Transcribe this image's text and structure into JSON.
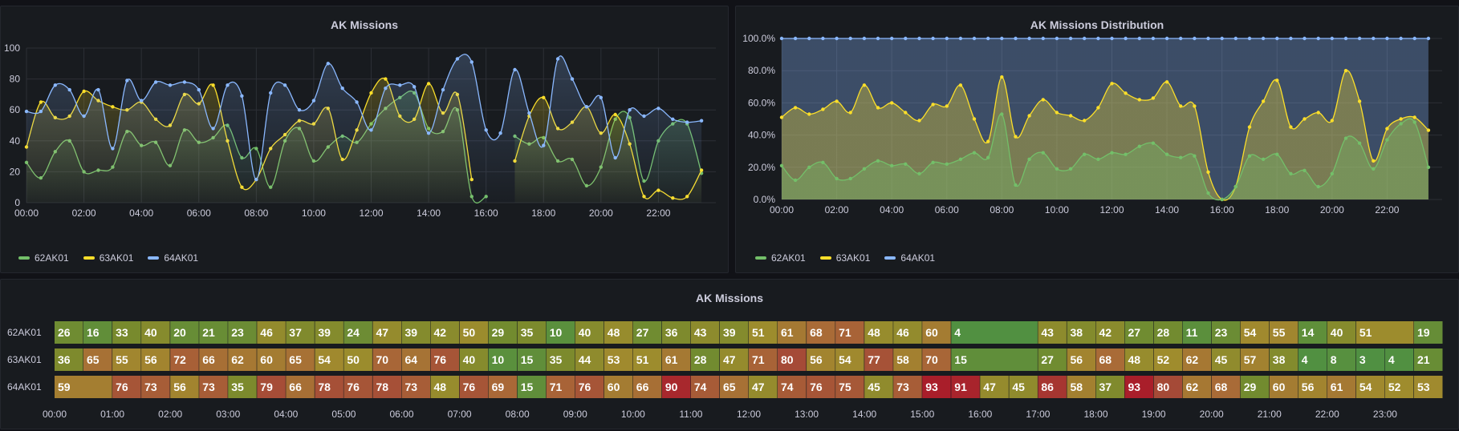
{
  "colors": {
    "s62": "#73bf69",
    "s63": "#fade2a",
    "s64": "#8ab8ff",
    "grid": "#2c2f36",
    "text": "#ccccdc",
    "bg": "#181b1f"
  },
  "panels": {
    "missions_title": "AK Missions",
    "distribution_title": "AK Missions Distribution",
    "table_title": "AK Missions"
  },
  "chart_data": [
    {
      "type": "line",
      "title": "AK Missions",
      "xlabel": "",
      "ylabel": "",
      "ylim": [
        0,
        100
      ],
      "yticks": [
        "0",
        "20",
        "40",
        "60",
        "80",
        "100"
      ],
      "xticks": [
        "00:00",
        "02:00",
        "04:00",
        "06:00",
        "08:00",
        "10:00",
        "12:00",
        "14:00",
        "16:00",
        "18:00",
        "20:00",
        "22:00"
      ],
      "x_hours": [
        0,
        0.5,
        1,
        1.5,
        2,
        2.5,
        3,
        3.5,
        4,
        4.5,
        5,
        5.5,
        6,
        6.5,
        7,
        7.5,
        8,
        8.5,
        9,
        9.5,
        10,
        10.5,
        11,
        11.5,
        12,
        12.5,
        13,
        13.5,
        14,
        14.5,
        15,
        15.5,
        16,
        16.5,
        17,
        17.5,
        18,
        18.5,
        19,
        19.5,
        20,
        20.5,
        21,
        21.5,
        22,
        22.5,
        23,
        23.5
      ],
      "series": [
        {
          "name": "62AK01",
          "color": "#73bf69",
          "values": [
            26,
            16,
            33,
            40,
            20,
            21,
            23,
            46,
            37,
            39,
            24,
            47,
            39,
            42,
            50,
            29,
            35,
            10,
            40,
            48,
            27,
            36,
            43,
            39,
            51,
            61,
            68,
            71,
            48,
            46,
            60,
            4,
            4,
            null,
            43,
            38,
            42,
            27,
            28,
            11,
            23,
            54,
            55,
            14,
            40,
            51,
            51,
            19
          ]
        },
        {
          "name": "63AK01",
          "color": "#fade2a",
          "values": [
            36,
            65,
            55,
            56,
            72,
            66,
            62,
            60,
            65,
            54,
            50,
            70,
            64,
            76,
            40,
            10,
            15,
            35,
            44,
            53,
            51,
            61,
            28,
            47,
            71,
            80,
            56,
            54,
            77,
            58,
            70,
            15,
            null,
            null,
            27,
            56,
            68,
            48,
            52,
            62,
            45,
            57,
            38,
            4,
            8,
            3,
            4,
            21
          ]
        },
        {
          "name": "64AK01",
          "color": "#8ab8ff",
          "values": [
            59,
            59,
            76,
            73,
            56,
            73,
            35,
            79,
            66,
            78,
            76,
            78,
            73,
            48,
            76,
            69,
            15,
            71,
            76,
            60,
            66,
            90,
            74,
            65,
            47,
            74,
            76,
            75,
            45,
            73,
            93,
            91,
            47,
            45,
            86,
            58,
            37,
            93,
            80,
            62,
            68,
            29,
            60,
            56,
            61,
            54,
            52,
            53
          ]
        }
      ],
      "legend": [
        "62AK01",
        "63AK01",
        "64AK01"
      ]
    },
    {
      "type": "area",
      "title": "AK Missions Distribution",
      "stacking": "percent",
      "ylim": [
        0,
        100
      ],
      "yticks": [
        "0.0%",
        "20.0%",
        "40.0%",
        "60.0%",
        "80.0%",
        "100.0%"
      ],
      "xticks": [
        "00:00",
        "02:00",
        "04:00",
        "06:00",
        "08:00",
        "10:00",
        "12:00",
        "14:00",
        "16:00",
        "18:00",
        "20:00",
        "22:00"
      ],
      "series": [
        {
          "name": "62AK01",
          "color": "#73bf69",
          "values": [
            21,
            12,
            20,
            23,
            13,
            13,
            19,
            24,
            21,
            22,
            16,
            23,
            22,
            25,
            29,
            26,
            53,
            9,
            25,
            29,
            19,
            19,
            28,
            25,
            29,
            28,
            33,
            35,
            28,
            26,
            27,
            4,
            0,
            8,
            27,
            25,
            28,
            16,
            18,
            8,
            16,
            38,
            35,
            19,
            37,
            47,
            48,
            20
          ]
        },
        {
          "name": "63AK01",
          "color": "#fade2a",
          "values": [
            51,
            57,
            53,
            56,
            61,
            54,
            71,
            57,
            60,
            54,
            49,
            59,
            58,
            71,
            50,
            36,
            76,
            39,
            52,
            62,
            54,
            52,
            49,
            57,
            72,
            66,
            62,
            63,
            73,
            58,
            58,
            17,
            0,
            8,
            45,
            61,
            74,
            45,
            50,
            54,
            49,
            80,
            61,
            24,
            44,
            50,
            51,
            43
          ]
        },
        {
          "name": "64AK01",
          "color": "#8ab8ff",
          "values": [
            100,
            100,
            100,
            100,
            100,
            100,
            100,
            100,
            100,
            100,
            100,
            100,
            100,
            100,
            100,
            100,
            100,
            100,
            100,
            100,
            100,
            100,
            100,
            100,
            100,
            100,
            100,
            100,
            100,
            100,
            100,
            100,
            100,
            100,
            100,
            100,
            100,
            100,
            100,
            100,
            100,
            100,
            100,
            100,
            100,
            100,
            100,
            100
          ]
        }
      ],
      "legend": [
        "62AK01",
        "63AK01",
        "64AK01"
      ]
    },
    {
      "type": "heatmap",
      "title": "AK Missions",
      "rows": [
        "62AK01",
        "63AK01",
        "64AK01"
      ],
      "xticks": [
        "00:00",
        "01:00",
        "02:00",
        "03:00",
        "04:00",
        "05:00",
        "06:00",
        "07:00",
        "08:00",
        "09:00",
        "10:00",
        "11:00",
        "12:00",
        "13:00",
        "14:00",
        "15:00",
        "16:00",
        "17:00",
        "18:00",
        "19:00",
        "20:00",
        "21:00",
        "22:00",
        "23:00"
      ],
      "cells": [
        [
          [
            "26",
            1
          ],
          [
            "16",
            1
          ],
          [
            "33",
            1
          ],
          [
            "40",
            1
          ],
          [
            "20",
            1
          ],
          [
            "21",
            1
          ],
          [
            "23",
            1
          ],
          [
            "46",
            1
          ],
          [
            "37",
            1
          ],
          [
            "39",
            1
          ],
          [
            "24",
            1
          ],
          [
            "47",
            1
          ],
          [
            "39",
            1
          ],
          [
            "42",
            1
          ],
          [
            "50",
            1
          ],
          [
            "29",
            1
          ],
          [
            "35",
            1
          ],
          [
            "10",
            1
          ],
          [
            "40",
            1
          ],
          [
            "48",
            1
          ],
          [
            "27",
            1
          ],
          [
            "36",
            1
          ],
          [
            "43",
            1
          ],
          [
            "39",
            1
          ],
          [
            "51",
            1
          ],
          [
            "61",
            1
          ],
          [
            "68",
            1
          ],
          [
            "71",
            1
          ],
          [
            "48",
            1
          ],
          [
            "46",
            1
          ],
          [
            "60",
            1
          ],
          [
            "4",
            3
          ],
          [
            "43",
            1
          ],
          [
            "38",
            1
          ],
          [
            "42",
            1
          ],
          [
            "27",
            1
          ],
          [
            "28",
            1
          ],
          [
            "11",
            1
          ],
          [
            "23",
            1
          ],
          [
            "54",
            1
          ],
          [
            "55",
            1
          ],
          [
            "14",
            1
          ],
          [
            "40",
            1
          ],
          [
            "51",
            2
          ],
          [
            "19",
            1
          ]
        ],
        [
          [
            "36",
            1
          ],
          [
            "65",
            1
          ],
          [
            "55",
            1
          ],
          [
            "56",
            1
          ],
          [
            "72",
            1
          ],
          [
            "66",
            1
          ],
          [
            "62",
            1
          ],
          [
            "60",
            1
          ],
          [
            "65",
            1
          ],
          [
            "54",
            1
          ],
          [
            "50",
            1
          ],
          [
            "70",
            1
          ],
          [
            "64",
            1
          ],
          [
            "76",
            1
          ],
          [
            "40",
            1
          ],
          [
            "10",
            1
          ],
          [
            "15",
            1
          ],
          [
            "35",
            1
          ],
          [
            "44",
            1
          ],
          [
            "53",
            1
          ],
          [
            "51",
            1
          ],
          [
            "61",
            1
          ],
          [
            "28",
            1
          ],
          [
            "47",
            1
          ],
          [
            "71",
            1
          ],
          [
            "80",
            1
          ],
          [
            "56",
            1
          ],
          [
            "54",
            1
          ],
          [
            "77",
            1
          ],
          [
            "58",
            1
          ],
          [
            "70",
            1
          ],
          [
            "15",
            3
          ],
          [
            "27",
            1
          ],
          [
            "56",
            1
          ],
          [
            "68",
            1
          ],
          [
            "48",
            1
          ],
          [
            "52",
            1
          ],
          [
            "62",
            1
          ],
          [
            "45",
            1
          ],
          [
            "57",
            1
          ],
          [
            "38",
            1
          ],
          [
            "4",
            1
          ],
          [
            "8",
            1
          ],
          [
            "3",
            1
          ],
          [
            "4",
            1
          ],
          [
            "21",
            1
          ]
        ],
        [
          [
            "59",
            2
          ],
          [
            "76",
            1
          ],
          [
            "73",
            1
          ],
          [
            "56",
            1
          ],
          [
            "73",
            1
          ],
          [
            "35",
            1
          ],
          [
            "79",
            1
          ],
          [
            "66",
            1
          ],
          [
            "78",
            1
          ],
          [
            "76",
            1
          ],
          [
            "78",
            1
          ],
          [
            "73",
            1
          ],
          [
            "48",
            1
          ],
          [
            "76",
            1
          ],
          [
            "69",
            1
          ],
          [
            "15",
            1
          ],
          [
            "71",
            1
          ],
          [
            "76",
            1
          ],
          [
            "60",
            1
          ],
          [
            "66",
            1
          ],
          [
            "90",
            1
          ],
          [
            "74",
            1
          ],
          [
            "65",
            1
          ],
          [
            "47",
            1
          ],
          [
            "74",
            1
          ],
          [
            "76",
            1
          ],
          [
            "75",
            1
          ],
          [
            "45",
            1
          ],
          [
            "73",
            1
          ],
          [
            "93",
            1
          ],
          [
            "91",
            1
          ],
          [
            "47",
            1
          ],
          [
            "45",
            1
          ],
          [
            "86",
            1
          ],
          [
            "58",
            1
          ],
          [
            "37",
            1
          ],
          [
            "93",
            1
          ],
          [
            "80",
            1
          ],
          [
            "62",
            1
          ],
          [
            "68",
            1
          ],
          [
            "29",
            1
          ],
          [
            "60",
            1
          ],
          [
            "56",
            1
          ],
          [
            "61",
            1
          ],
          [
            "54",
            1
          ],
          [
            "52",
            1
          ],
          [
            "53",
            1
          ]
        ]
      ]
    }
  ]
}
